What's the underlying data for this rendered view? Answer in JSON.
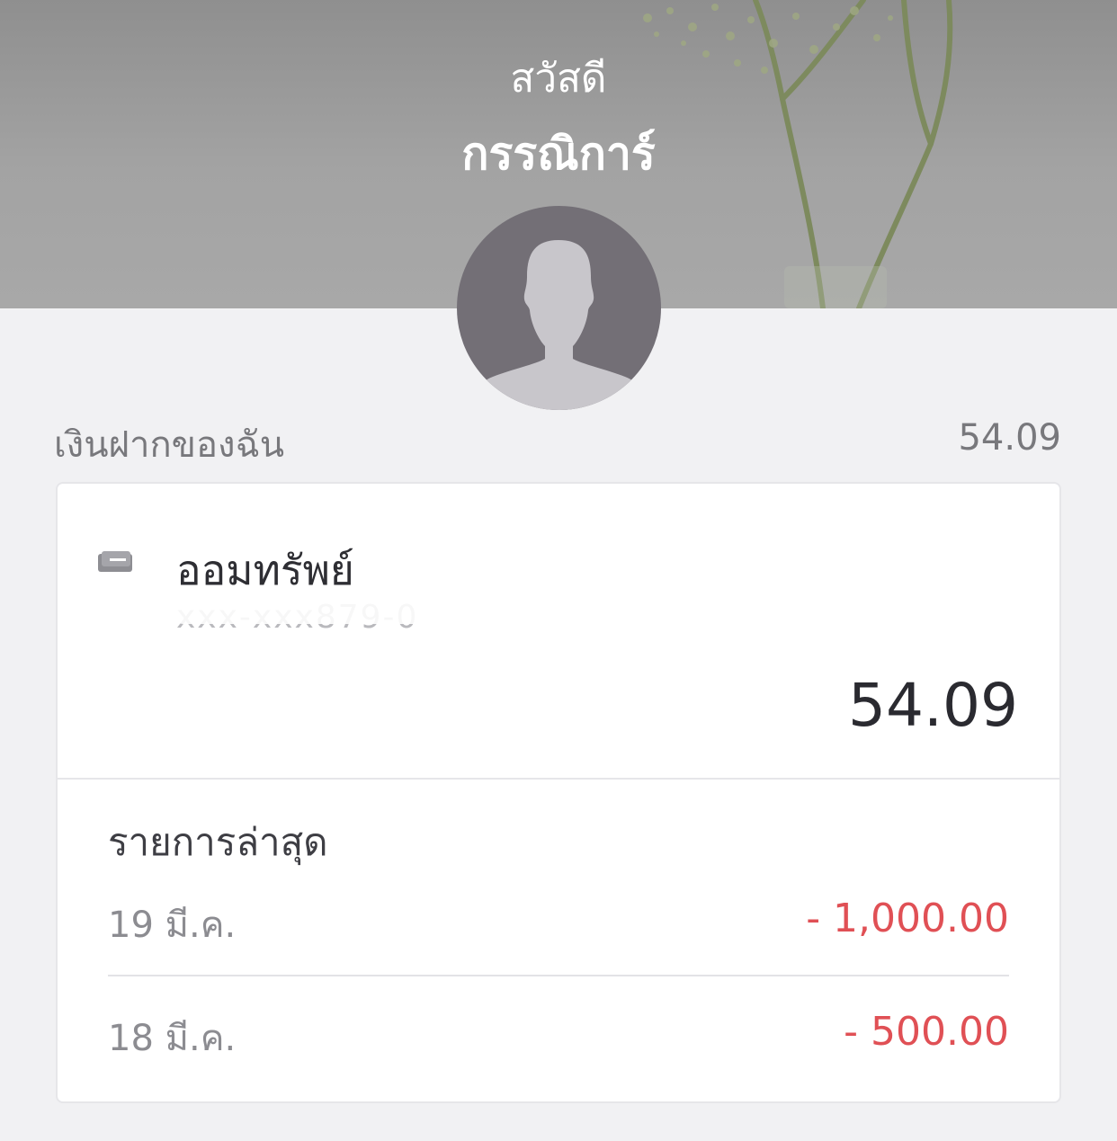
{
  "header": {
    "greeting": "สวัสดี",
    "user_name": "กรรณิการ์"
  },
  "deposits": {
    "label": "เงินฝากของฉัน",
    "total": "54.09"
  },
  "account": {
    "icon": "card-icon",
    "name": "ออมทรัพย์",
    "number_masked": "xxx-xxx879-0",
    "balance": "54.09"
  },
  "recent": {
    "title": "รายการล่าสุด",
    "transactions": [
      {
        "date": "19 มี.ค.",
        "amount": "- 1,000.00"
      },
      {
        "date": "18 มี.ค.",
        "amount": "- 500.00"
      }
    ]
  },
  "colors": {
    "page_background": "#f1f1f3",
    "negative_amount": "#e05055",
    "avatar_background": "#736f76",
    "avatar_silhouette": "#c8c6cb"
  }
}
